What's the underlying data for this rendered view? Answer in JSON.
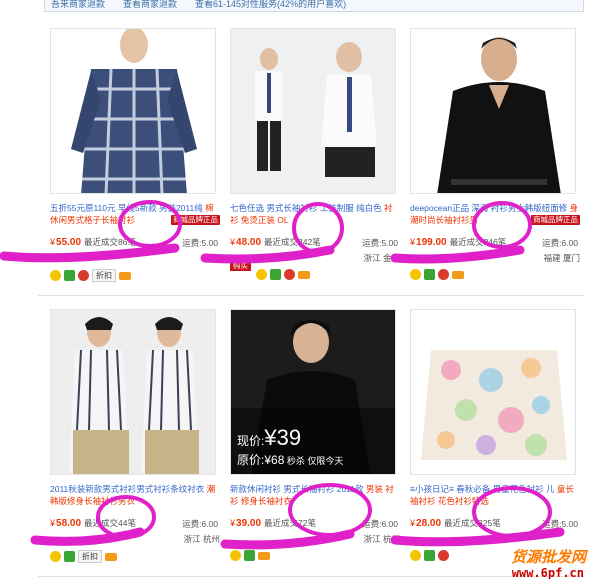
{
  "topbar": {
    "items": [
      "吾来商家退款",
      "查看商家退款",
      "查看61-145对性服务(42%的用户喜欢)"
    ]
  },
  "products": [
    {
      "title_a": "五折55元原110元 早线5新款 男装2011纯",
      "title_b": "棉休闲男式格子长袖衬衫",
      "badge": "商城品牌正品",
      "price": "55.00",
      "sold": "最近成交86笔",
      "shipping": "运费:5.00",
      "location": "上海",
      "tag": "",
      "discount": "折扣"
    },
    {
      "title_a": "七色任选 男式长袖衬衫 工装制服 纯白色",
      "title_b": "衬衫 免烫正装 OL",
      "badge": "",
      "price": "48.00",
      "sold": "最近成交242笔",
      "shipping": "运费:5.00",
      "location": "浙江 金华",
      "tag": "购买",
      "discount": ""
    },
    {
      "title_a": "deepocean正品 深海 衬衫男士韩版纽面修",
      "title_b": "身 潮时尚长袖衬衫男",
      "badge": "商城品牌正品",
      "price": "199.00",
      "sold": "最近成交246笔",
      "shipping": "运费:6.00",
      "location": "福建 厦门",
      "tag": "",
      "discount": ""
    },
    {
      "title_a": "2011秋装新款男式衬衫男式衬衫条纹衬衣",
      "title_b": "潮韩版修身长袖衬衫男衣",
      "badge": "",
      "price": "58.00",
      "sold": "最近成交44笔",
      "shipping": "运费:6.00",
      "location": "浙江 杭州",
      "tag": "",
      "discount": "折扣"
    },
    {
      "title_a": "新款休闲衬衫 男式长袖衬衫 2011款",
      "title_b": "男装 衬衫 修身长袖衬衣",
      "badge": "",
      "price": "39.00",
      "sold": "最近成交72笔",
      "shipping": "运费:6.00",
      "location": "浙江 杭州",
      "tag": "",
      "discount": "",
      "overlay": {
        "now": "现价:",
        "price": "¥39",
        "orig": "原价:",
        "orig_price": "¥68",
        "promo": "秒杀 仅限今天"
      }
    },
    {
      "title_a": "≡小孩日记≡ 春秋必备 男童花色衬衫 儿",
      "title_b": "童长袖衬衫 花色衬衫特选",
      "badge": "",
      "price": "28.00",
      "sold": "最近成交325笔",
      "shipping": "运费:5.00",
      "location": "",
      "tag": "",
      "discount": ""
    }
  ],
  "currency": "¥",
  "watermark": {
    "line1": "货源批发网",
    "line2": "www.6pf.cn"
  }
}
